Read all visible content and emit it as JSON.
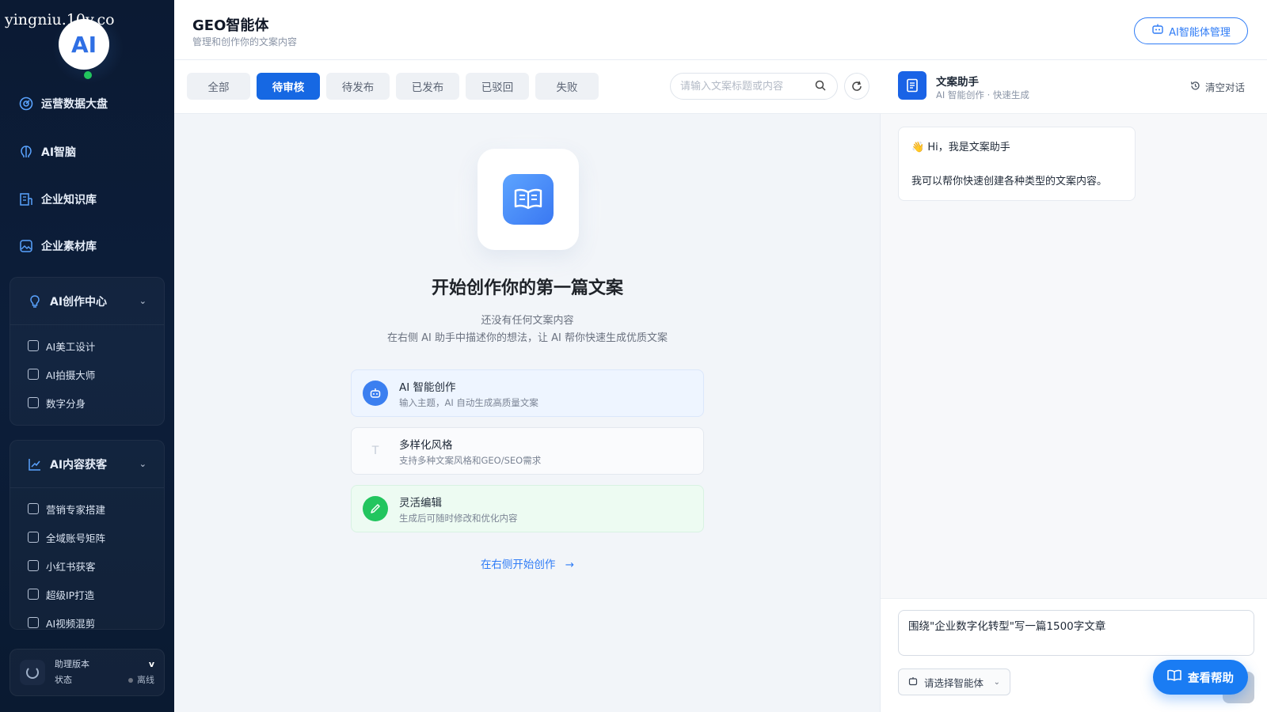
{
  "watermark": "yingniu.10v.co",
  "sidebar": {
    "logo_text": "AI",
    "nav": [
      {
        "label": "运营数据大盘",
        "icon": "dashboard-icon"
      },
      {
        "label": "AI智脑",
        "icon": "brain-icon"
      },
      {
        "label": "企业知识库",
        "icon": "knowledge-base-icon"
      },
      {
        "label": "企业素材库",
        "icon": "image-library-icon"
      }
    ],
    "groups": [
      {
        "label": "AI创作中心",
        "icon": "lightbulb-icon",
        "items": [
          {
            "label": "AI美工设计",
            "icon": "design-icon"
          },
          {
            "label": "AI拍摄大师",
            "icon": "camera-icon"
          },
          {
            "label": "数字分身",
            "icon": "avatar-card-icon"
          }
        ]
      },
      {
        "label": "AI内容获客",
        "icon": "trend-chart-icon",
        "items": [
          {
            "label": "营销专家搭建",
            "icon": "user-icon"
          },
          {
            "label": "全域账号矩阵",
            "icon": "document-icon"
          },
          {
            "label": "小红书获客",
            "icon": "book-icon"
          },
          {
            "label": "超级IP打造",
            "icon": "id-badge-icon"
          },
          {
            "label": "AI视频混剪",
            "icon": "video-icon"
          }
        ]
      }
    ],
    "footer": {
      "version_label": "助理版本",
      "version_value": "v",
      "status_label": "状态",
      "status_value": "离线"
    }
  },
  "header": {
    "title": "GEO智能体",
    "subtitle": "管理和创作你的文案内容",
    "manage_button": "AI智能体管理"
  },
  "tabs": [
    {
      "label": "全部",
      "active": false
    },
    {
      "label": "待审核",
      "active": true
    },
    {
      "label": "待发布",
      "active": false
    },
    {
      "label": "已发布",
      "active": false
    },
    {
      "label": "已驳回",
      "active": false
    },
    {
      "label": "失败",
      "active": false
    }
  ],
  "search": {
    "placeholder": "请输入文案标题或内容",
    "value": ""
  },
  "empty_state": {
    "title": "开始创作你的第一篇文案",
    "line1": "还没有任何文案内容",
    "line2": "在右侧 AI 助手中描述你的想法，让 AI 帮你快速生成优质文案",
    "features": [
      {
        "title": "AI 智能创作",
        "desc": "输入主题，AI 自动生成高质量文案",
        "icon": "robot-icon",
        "color": "#3b7ff0"
      },
      {
        "title": "多样化风格",
        "desc": "支持多种文案风格和GEO/SEO需求",
        "icon": "text-style-icon",
        "color": "#e9edf3"
      },
      {
        "title": "灵活编辑",
        "desc": "生成后可随时修改和优化内容",
        "icon": "edit-pencil-icon",
        "color": "#22c55e"
      }
    ],
    "start_link": "在右侧开始创作"
  },
  "chat": {
    "title": "文案助手",
    "subtitle": "AI 智能创作 · 快速生成",
    "clear_label": "清空对话",
    "greeting": "Hi，我是文案助手",
    "greeting_emoji": "👋",
    "message": "我可以帮你快速创建各种类型的文案内容。",
    "input_value": "围绕\"企业数字化转型\"写一篇1500字文章",
    "agent_select": "请选择智能体",
    "help_button": "查看帮助"
  },
  "colors": {
    "primary": "#1668e3",
    "sidebar_bg": "#0b1a33",
    "accent": "#2f7cf6",
    "success": "#22c55e"
  }
}
